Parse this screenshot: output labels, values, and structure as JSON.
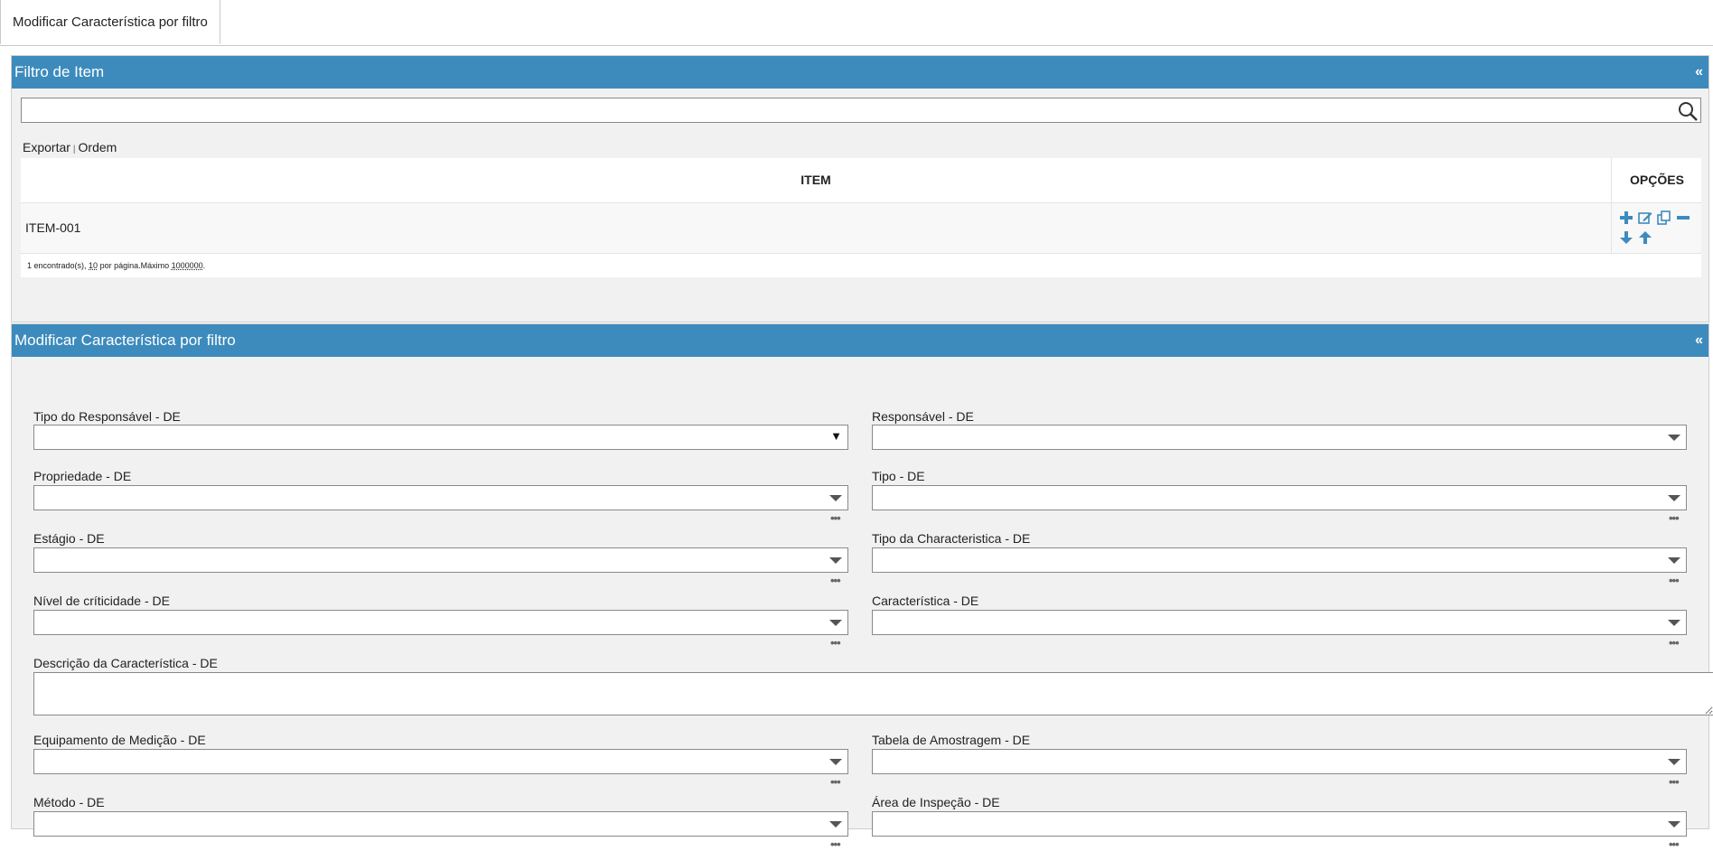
{
  "tabs": {
    "active": "Modificar Característica por filtro"
  },
  "filter_panel": {
    "title": "Filtro de Item",
    "collapse": "«",
    "search": {
      "value": ""
    },
    "links": {
      "export": "Exportar",
      "sep": "|",
      "order": "Ordem"
    },
    "grid": {
      "col_item": "ITEM",
      "col_options": "OPÇÕES",
      "rows": [
        {
          "item": "ITEM-001"
        }
      ],
      "footer": {
        "found": "1 encontrado(s), ",
        "per_page_num": "10",
        "per_page_text": " por página.Máximo ",
        "max": "1000000",
        "end": "."
      }
    }
  },
  "edit_panel": {
    "title": "Modificar Característica por filtro",
    "collapse": "«",
    "fields": {
      "tipo_responsavel": "Tipo do Responsável - DE",
      "responsavel": "Responsável - DE",
      "propriedade": "Propriedade - DE",
      "tipo": "Tipo - DE",
      "estagio": "Estágio - DE",
      "tipo_char": "Tipo da Characteristica - DE",
      "nivel": "Nível de críticidade - DE",
      "caracteristica": "Característica - DE",
      "descricao": "Descrição da Característica - DE",
      "equipamento": "Equipamento de Medição - DE",
      "tabela": "Tabela de Amostragem - DE",
      "metodo": "Método - DE",
      "area": "Área de Inspeção - DE"
    },
    "more": "•••",
    "caret_black": "▼"
  },
  "colors": {
    "header_bg": "#3d8bbd",
    "icon_blue": "#3d8bbd"
  }
}
